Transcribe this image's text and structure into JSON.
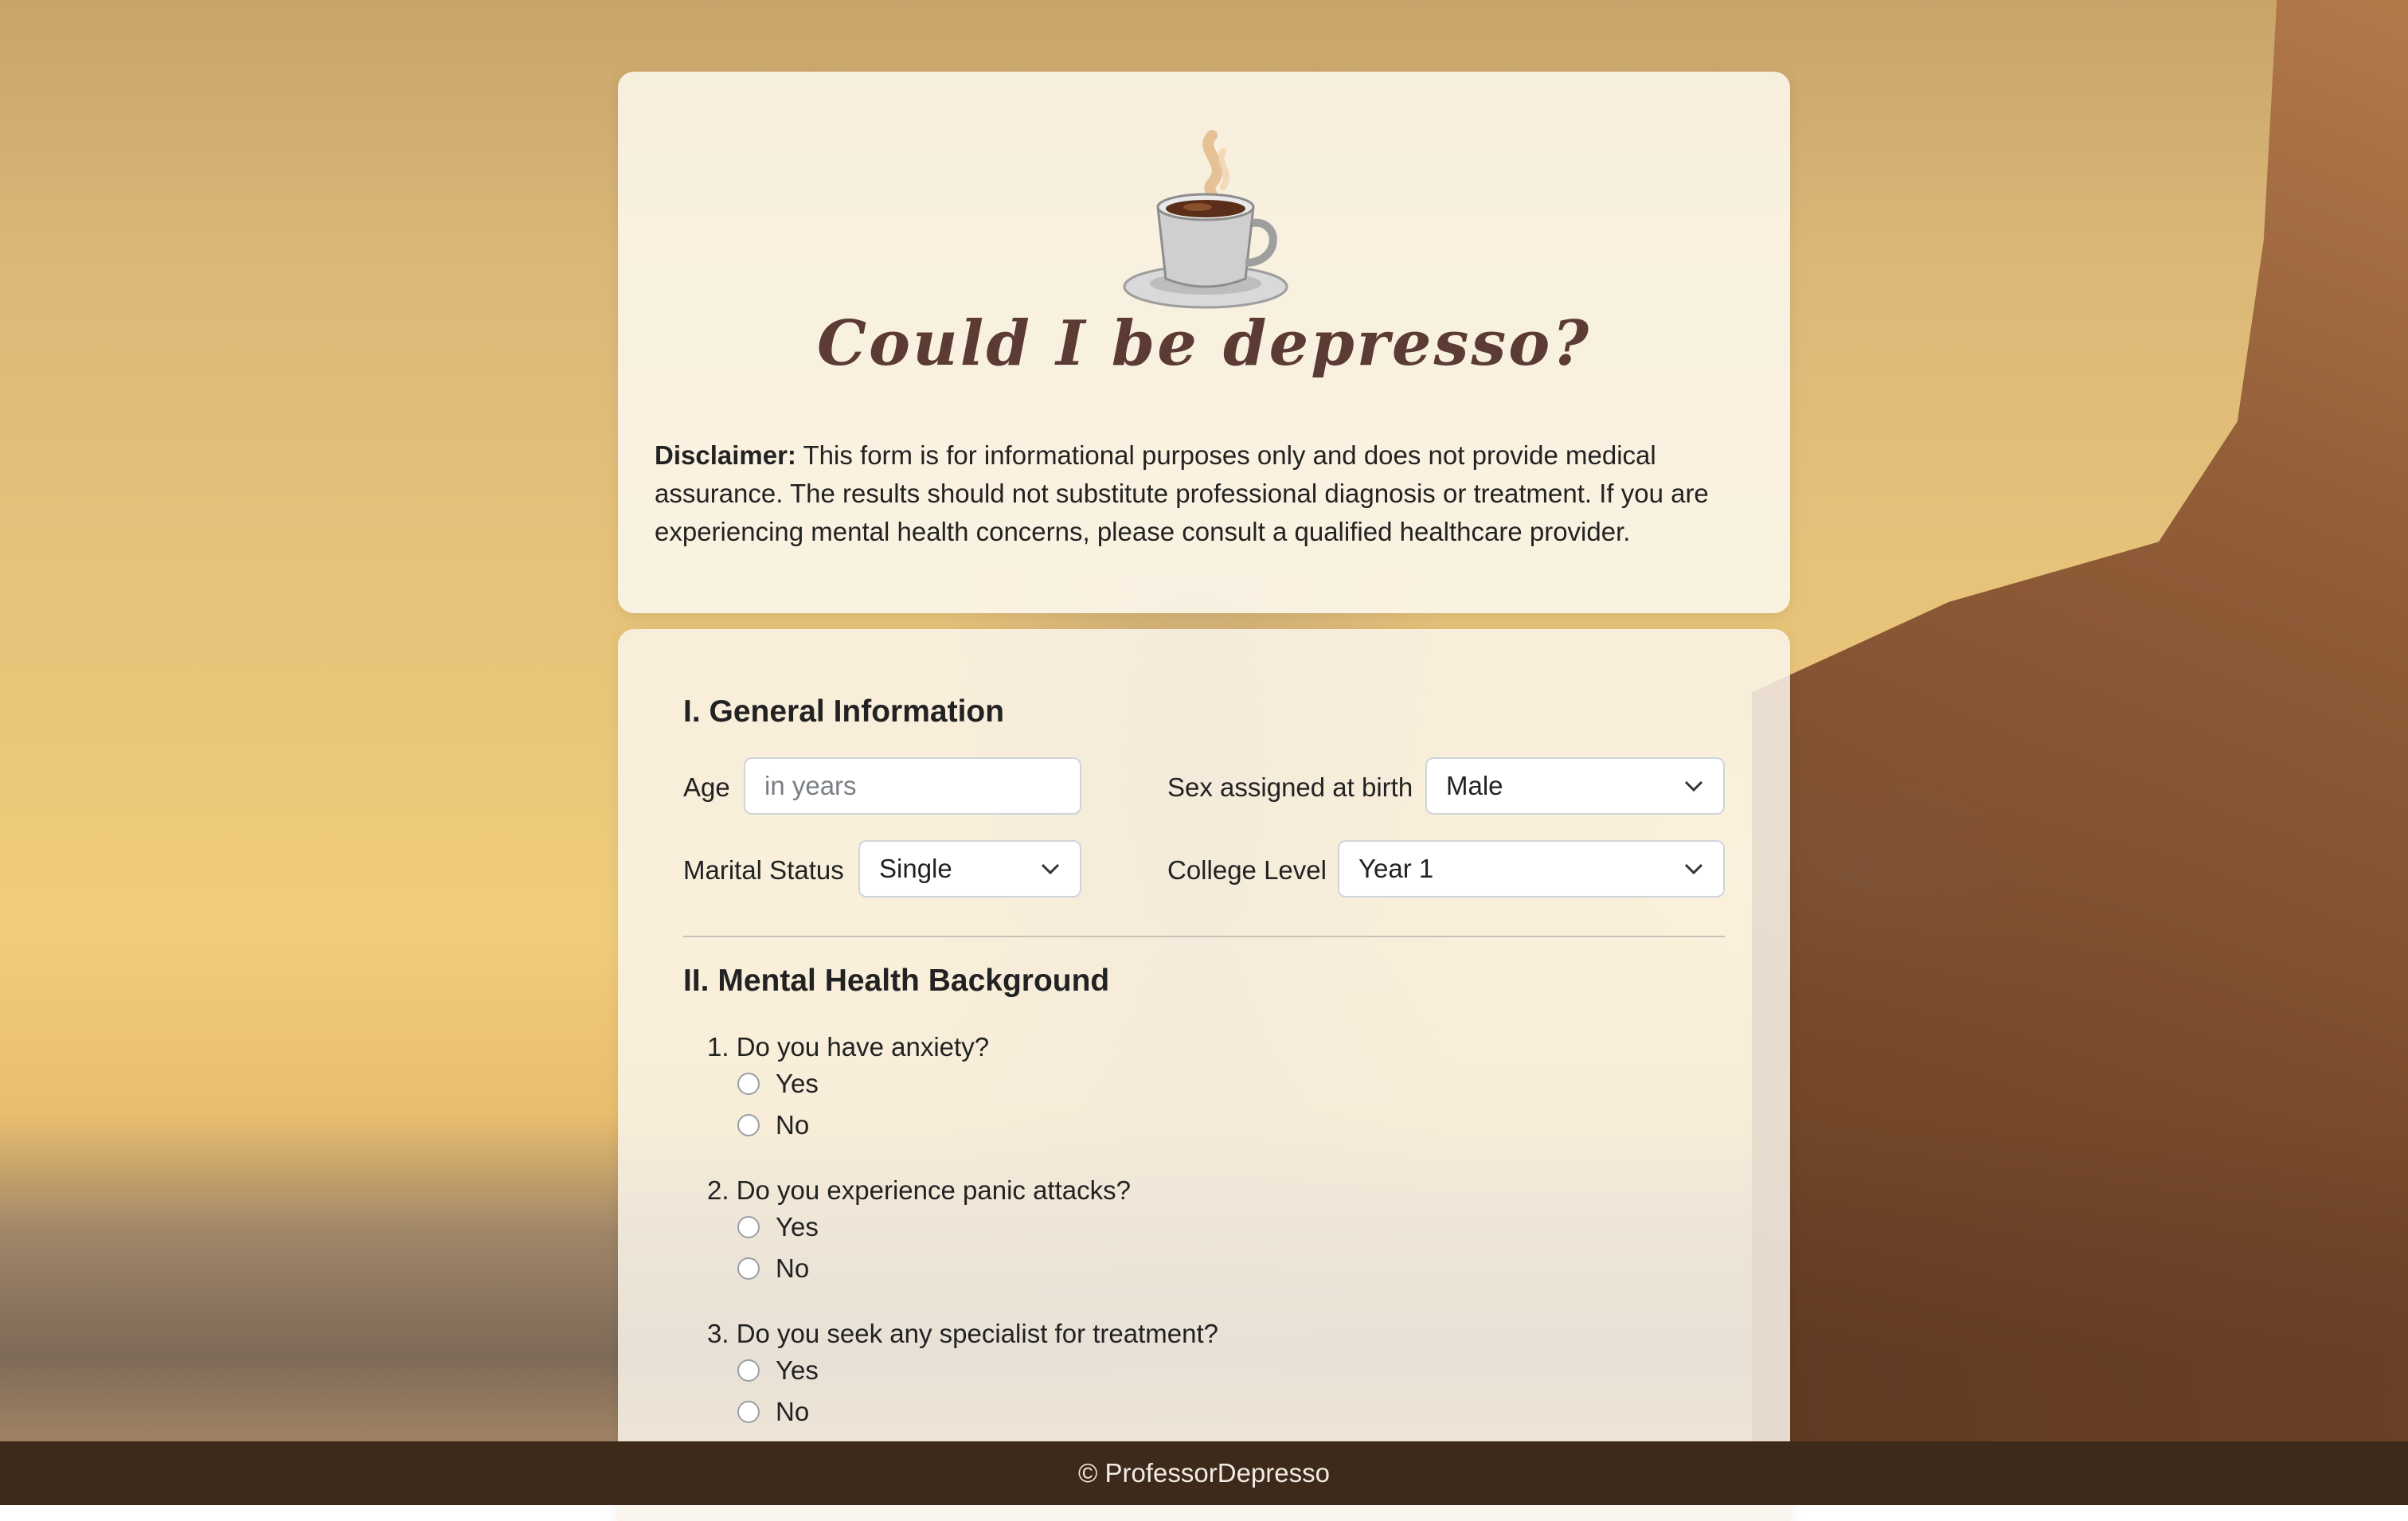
{
  "header": {
    "logo_icon": "coffee-cup-icon",
    "title": "Could I be depresso?",
    "disclaimer_label": "Disclaimer:",
    "disclaimer_text": " This form is for informational purposes only and does not provide medical assurance. The results should not substitute professional diagnosis or treatment. If you are experiencing mental health concerns, please consult a qualified healthcare provider."
  },
  "general": {
    "heading": "I. General Information",
    "age_label": "Age",
    "age_placeholder": "in years",
    "sex_label": "Sex assigned at birth",
    "sex_value": "Male",
    "marital_label": "Marital Status",
    "marital_value": "Single",
    "college_label": "College Level",
    "college_value": "Year 1"
  },
  "mental": {
    "heading": "II. Mental Health Background",
    "questions": [
      {
        "text": "1. Do you have anxiety?",
        "options": [
          "Yes",
          "No"
        ]
      },
      {
        "text": "2. Do you experience panic attacks?",
        "options": [
          "Yes",
          "No"
        ]
      },
      {
        "text": "3. Do you seek any specialist for treatment?",
        "options": [
          "Yes",
          "No"
        ]
      }
    ]
  },
  "footer": {
    "text": "© ProfessorDepresso"
  },
  "colors": {
    "title": "#5b3b33",
    "footer_bg": "#3d2a1a"
  }
}
